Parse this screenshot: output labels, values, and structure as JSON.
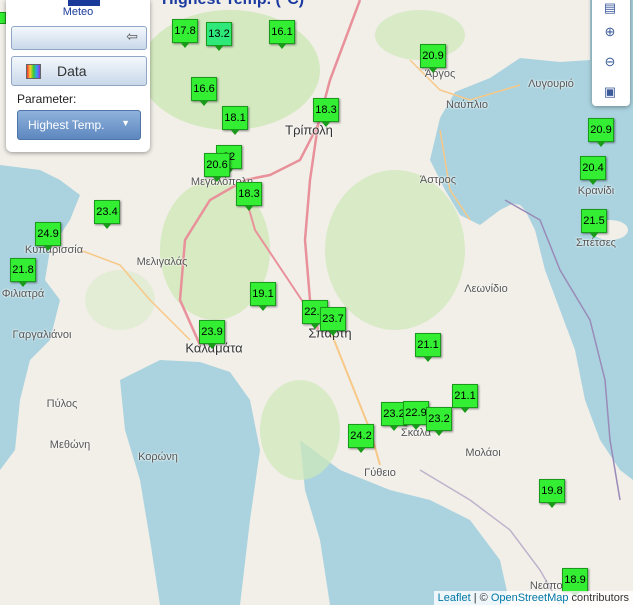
{
  "title": "Highest Temp. (°C)",
  "logo": {
    "text": "Meteo"
  },
  "panel": {
    "back_icon": "back-arrow-icon",
    "data_label": "Data",
    "data_icon": "color-palette-icon",
    "parameter_label": "Parameter:",
    "parameter_value": "Highest Temp.",
    "parameter_caret_icon": "caret-down-icon"
  },
  "toolbar": {
    "layers_icon": "layers-icon",
    "zoom_in_icon": "zoom-in-icon",
    "zoom_out_icon": "zoom-out-icon",
    "fit_icon": "fit-extent-icon"
  },
  "attribution": {
    "leaflet": "Leaflet",
    "separator": " | © ",
    "osm": "OpenStreetMap",
    "suffix": " contributors"
  },
  "colors": {
    "marker_fill": "#33ee33",
    "marker_border": "#1a9a1a",
    "sea": "#aad3df",
    "land": "#f2efe9",
    "forest": "#cfe8b8",
    "road": "#e8919a",
    "title": "#1a3aa0"
  },
  "places": [
    {
      "name": "Άργος"
    },
    {
      "name": "Ναύπλιο"
    },
    {
      "name": "Λυγουριό"
    },
    {
      "name": "Τρίπολη"
    },
    {
      "name": "Μεγαλόπολη"
    },
    {
      "name": "Άστρος"
    },
    {
      "name": "Κρανίδι"
    },
    {
      "name": "Σπέτσες"
    },
    {
      "name": "Κυπαρισσία"
    },
    {
      "name": "Φιλιατρά"
    },
    {
      "name": "Μελιγαλάς"
    },
    {
      "name": "Λεωνίδιο"
    },
    {
      "name": "Γαργαλιάνοι"
    },
    {
      "name": "Καλαμάτα"
    },
    {
      "name": "Σπάρτη"
    },
    {
      "name": "Πύλος"
    },
    {
      "name": "Μεθώνη"
    },
    {
      "name": "Κορώνη"
    },
    {
      "name": "Σκάλα"
    },
    {
      "name": "Μολάοι"
    },
    {
      "name": "Γύθειο"
    },
    {
      "name": "Νεάπολη"
    }
  ],
  "stations": [
    {
      "value": "17.8"
    },
    {
      "value": "13.2"
    },
    {
      "value": "16.1"
    },
    {
      "value": "20.9"
    },
    {
      "value": "16.6"
    },
    {
      "value": "18.3"
    },
    {
      "value": "18.1"
    },
    {
      "value": "20.9"
    },
    {
      "value": "22"
    },
    {
      "value": "20.6"
    },
    {
      "value": "20.4"
    },
    {
      "value": "18.3"
    },
    {
      "value": "21.5"
    },
    {
      "value": "23.4"
    },
    {
      "value": "24.9"
    },
    {
      "value": "21.8"
    },
    {
      "value": "19.1"
    },
    {
      "value": "22.7"
    },
    {
      "value": "23.7"
    },
    {
      "value": "23.9"
    },
    {
      "value": "21.1"
    },
    {
      "value": "21.1"
    },
    {
      "value": "23.2"
    },
    {
      "value": "22.9"
    },
    {
      "value": "23.2"
    },
    {
      "value": "24.2"
    },
    {
      "value": "19.8"
    },
    {
      "value": "18.9"
    }
  ]
}
